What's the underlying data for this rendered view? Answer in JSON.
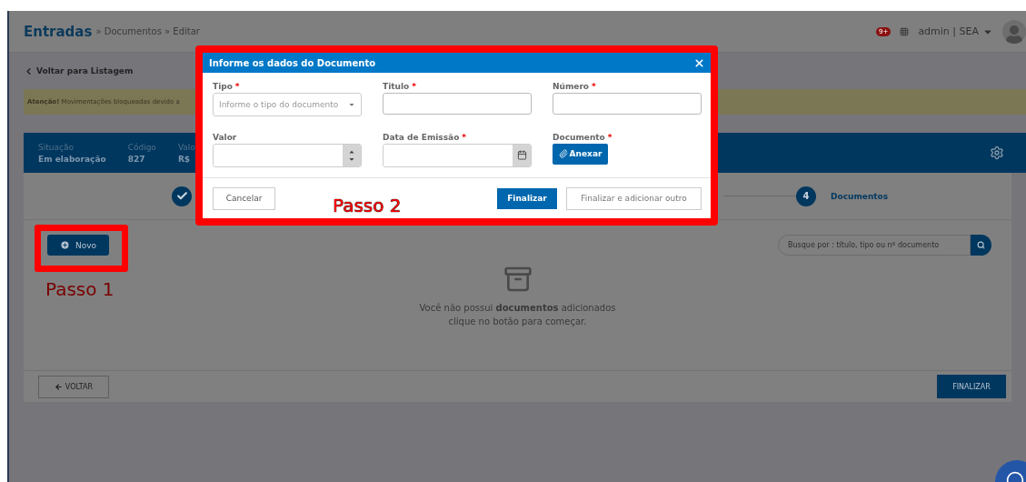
{
  "header": {
    "title": "Entradas",
    "breadcrumb": "» Documentos » Editar",
    "notification_count": "9+",
    "user": "admin | SEA"
  },
  "back_link": "Voltar para Listagem",
  "alert": "**Atenção!** Movimentações bloqueadas devido a",
  "info": [
    {
      "label": "Situação",
      "value": "Em elaboração"
    },
    {
      "label": "Código",
      "value": "827"
    },
    {
      "label": "Valo",
      "value": "R$"
    }
  ],
  "steps": [
    {
      "kind": "done"
    },
    {
      "kind": "number",
      "number": "4",
      "label": "Documentos"
    }
  ],
  "new_button": "Novo",
  "search": {
    "placeholder": "Busque por : título, tipo ou nº documento"
  },
  "empty_state": [
    "Você não possui **documentos** adicionados",
    "clique no botão para começar."
  ],
  "footer": {
    "back": "VOLTAR",
    "finish": "FINALIZAR"
  },
  "modal": {
    "title": "Informe os dados do Documento",
    "fields": [
      {
        "kind": "select",
        "label": "Tipo",
        "required_mark": "*",
        "placeholder": "Informe o tipo do documento"
      },
      {
        "kind": "text",
        "label": "Titulo",
        "required_mark": "*"
      },
      {
        "kind": "text",
        "label": "Número",
        "required_mark": "*"
      },
      {
        "kind": "number",
        "label": "Valor"
      },
      {
        "kind": "date",
        "label": "Data de Emissão",
        "required_mark": "*"
      },
      {
        "kind": "file",
        "label": "Documento",
        "required_mark": "*",
        "button": "Anexar"
      }
    ],
    "cancel": "Cancelar",
    "finish": "Finalizar",
    "finish_add": "Finalizar e adicionar outro"
  },
  "annotations": [
    "Passo 1",
    "Passo 2"
  ]
}
